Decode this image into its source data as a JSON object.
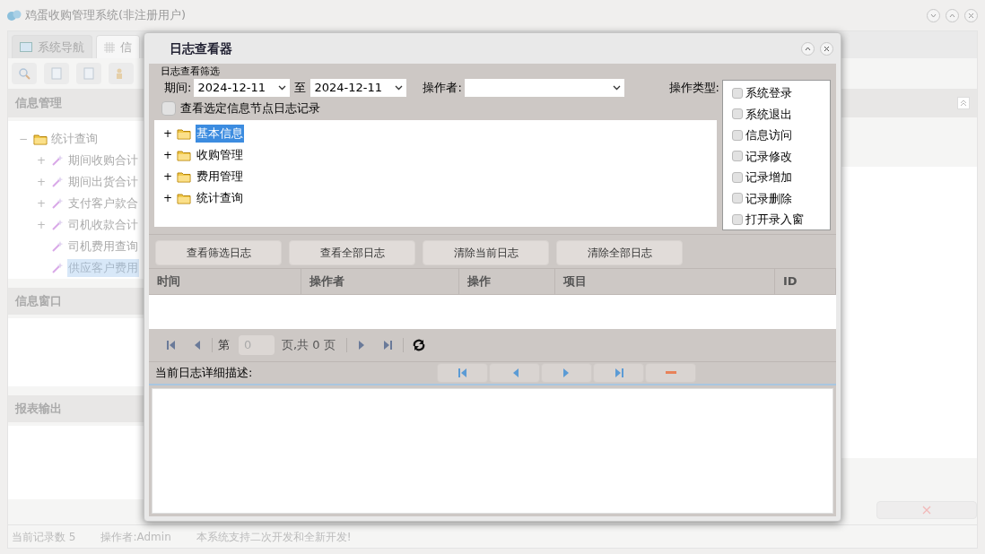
{
  "app": {
    "title": "鸡蛋收购管理系统(非注册用户)",
    "tabs": [
      {
        "label": "系统导航",
        "selected": false
      },
      {
        "label": "信",
        "selected": true
      }
    ],
    "left_panel": {
      "title": "信息管理",
      "tree": [
        {
          "toggle": "−",
          "label": "统计查询",
          "children": [
            {
              "toggle": "+",
              "label": "期间收购合计",
              "selected": false
            },
            {
              "toggle": "+",
              "label": "期间出货合计",
              "selected": false
            },
            {
              "toggle": "+",
              "label": "支付客户款合",
              "selected": false
            },
            {
              "toggle": "+",
              "label": "司机收款合计",
              "selected": false
            },
            {
              "label": "司机费用查询",
              "selected": false
            },
            {
              "label": "供应客户费用",
              "selected": true
            }
          ]
        }
      ]
    },
    "sections": [
      {
        "title": "信息窗口"
      },
      {
        "title": "报表输出"
      }
    ],
    "status_bar": [
      "当前记录数 5",
      "操作者:Admin",
      "本系统支持二次开发和全新开发!"
    ]
  },
  "dialog": {
    "title": "日志查看器",
    "filter": {
      "group_label": "日志查看筛选",
      "period_label": "期间:",
      "from": "2024-12-11",
      "to_label": "至",
      "to": "2024-12-11",
      "operator_label": "操作者:",
      "op_types_label": "操作类型:",
      "op_types": [
        {
          "label": "系统登录",
          "checked": false
        },
        {
          "label": "系统退出",
          "checked": false
        },
        {
          "label": "信息访问",
          "checked": false
        },
        {
          "label": "记录修改",
          "checked": false
        },
        {
          "label": "记录增加",
          "checked": false
        },
        {
          "label": "记录删除",
          "checked": false
        },
        {
          "label": "打开录入窗",
          "checked": false
        }
      ],
      "node_filter": {
        "label": "查看选定信息节点日志记录",
        "checked": false
      },
      "tree": [
        {
          "toggle": "+",
          "label": "基本信息",
          "selected": true
        },
        {
          "toggle": "+",
          "label": "收购管理",
          "selected": false
        },
        {
          "toggle": "+",
          "label": "费用管理",
          "selected": false
        },
        {
          "toggle": "+",
          "label": "统计查询",
          "selected": false
        }
      ]
    },
    "buttons": [
      "查看筛选日志",
      "查看全部日志",
      "清除当前日志",
      "清除全部日志"
    ],
    "table": {
      "columns": [
        "时间",
        "操作者",
        "操作",
        "项目",
        "ID"
      ]
    },
    "pager": {
      "page_prefix": "第",
      "page": "0",
      "page_suffix": "页,共 0 页"
    },
    "detail": {
      "label": "当前日志详细描述:"
    }
  }
}
